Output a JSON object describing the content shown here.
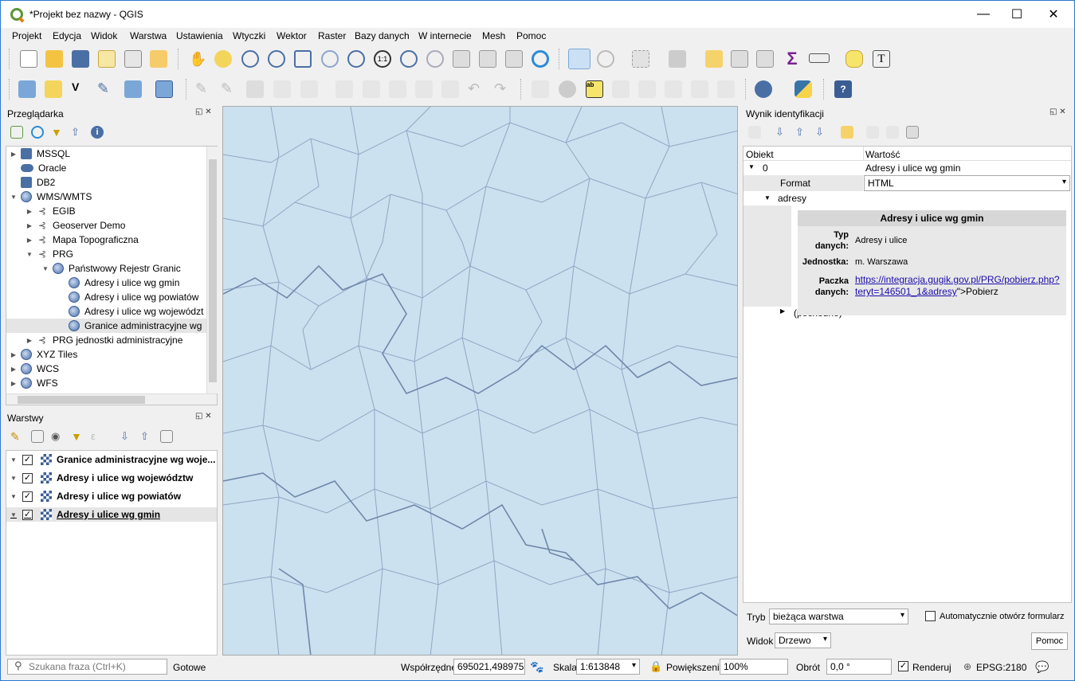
{
  "window": {
    "title": "*Projekt bez nazwy - QGIS",
    "minimize": "—",
    "maximize": "☐",
    "close": "✕"
  },
  "menu": [
    "Projekt",
    "Edycja",
    "Widok",
    "Warstwa",
    "Ustawienia",
    "Wtyczki",
    "Wektor",
    "Raster",
    "Bazy danych",
    "W internecie",
    "Mesh",
    "Pomoc"
  ],
  "browser": {
    "title": "Przeglądarka",
    "items": [
      {
        "label": "MSSQL",
        "icon": "mssql-icon"
      },
      {
        "label": "Oracle",
        "icon": "oracle-icon"
      },
      {
        "label": "DB2",
        "icon": "db2-icon"
      },
      {
        "label": "WMS/WMTS",
        "icon": "globe-icon"
      },
      {
        "label": "EGIB",
        "icon": "connection-icon"
      },
      {
        "label": "Geoserver Demo",
        "icon": "connection-icon"
      },
      {
        "label": "Mapa Topograficzna",
        "icon": "connection-icon"
      },
      {
        "label": "PRG",
        "icon": "connection-icon"
      },
      {
        "label": "Państwowy Rejestr Granic",
        "icon": "globe-icon"
      },
      {
        "label": "Adresy i ulice wg gmin",
        "icon": "globe-icon"
      },
      {
        "label": "Adresy i ulice wg powiatów",
        "icon": "globe-icon"
      },
      {
        "label": "Adresy i ulice wg województ",
        "icon": "globe-icon"
      },
      {
        "label": "Granice administracyjne wg",
        "icon": "globe-icon"
      },
      {
        "label": "PRG jednostki administracyjne",
        "icon": "connection-icon"
      },
      {
        "label": "XYZ Tiles",
        "icon": "globe-icon"
      },
      {
        "label": "WCS",
        "icon": "globe-icon"
      },
      {
        "label": "WFS",
        "icon": "globe-icon"
      }
    ]
  },
  "layers": {
    "title": "Warstwy",
    "items": [
      {
        "label": "Granice administracyjne wg woje...",
        "checked": true
      },
      {
        "label": "Adresy i ulice wg województw",
        "checked": true
      },
      {
        "label": "Adresy i ulice wg powiatów",
        "checked": true
      },
      {
        "label": "Adresy i ulice wg gmin",
        "checked": true
      }
    ]
  },
  "identify": {
    "title": "Wynik identyfikacji",
    "col_object": "Obiekt",
    "col_value": "Wartość",
    "row0_key": "0",
    "row0_value": "Adresy i ulice wg gmin",
    "format_label": "Format",
    "format_value": "HTML",
    "adresy_label": "adresy",
    "html_header": "Adresy i ulice wg gmin",
    "typ_label1": "Typ",
    "typ_label2": "danych:",
    "typ_value": "Adresy i ulice",
    "jednostka_label": "Jednostka:",
    "jednostka_value": "m. Warszawa",
    "paczka_label1": "Paczka",
    "paczka_label2": "danych:",
    "paczka_link1": "https://integracja.gugik.gov.pl/PRG/pobierz.php?",
    "paczka_link2": "teryt=146501_1&adresy",
    "paczka_tail": "\">Pobierz",
    "pochodne": "(pochodne)",
    "tryb_label": "Tryb",
    "tryb_value": "bieżąca warstwa",
    "auto_form": "Automatycznie otwórz formularz",
    "widok_label": "Widok",
    "widok_value": "Drzewo",
    "help": "Pomoc"
  },
  "status": {
    "search_placeholder": "Szukana fraza (Ctrl+K)",
    "ready": "Gotowe",
    "coords_label": "Współrzędne",
    "coords_value": "695021,498975",
    "scale_label": "Skala",
    "scale_value": "1:613848",
    "zoom_label": "Powiększenie",
    "zoom_value": "100%",
    "rotation_label": "Obrót",
    "rotation_value": "0,0 °",
    "render_label": "Renderuj",
    "crs": "EPSG:2180"
  }
}
